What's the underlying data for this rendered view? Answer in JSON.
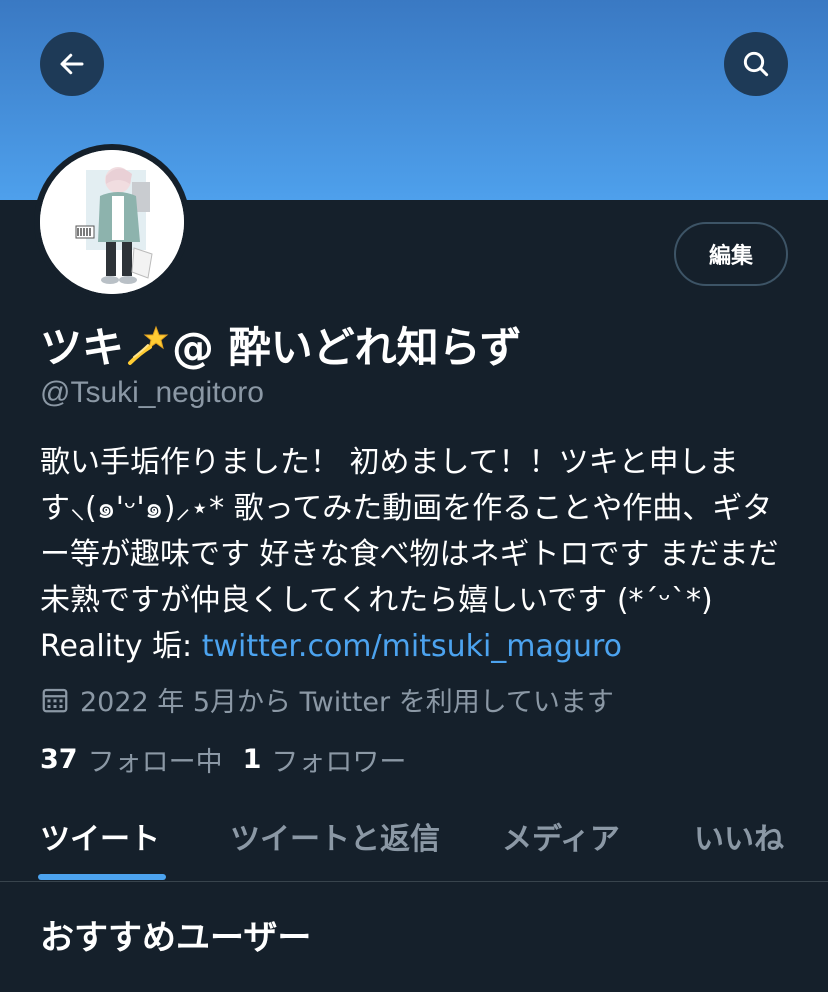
{
  "header": {
    "back_icon": "arrow-left-icon",
    "search_icon": "search-icon",
    "banner_color": "#4ea0ec"
  },
  "profile": {
    "edit_label": "編集",
    "name_prefix": "ツキ",
    "name_emoji": "dizzy-star-emoji",
    "name_suffix": "@ 酔いどれ知らず",
    "handle": "@Tsuki_negitoro",
    "bio_text": "歌い手垢作りました！ 初めまして！！ツキと申します⸜(๑'ᵕ'๑)⸝⋆* 歌ってみた動画を作ることや作曲、ギター等が趣味です 好きな食べ物はネギトロです まだまだ未熟ですが仲良くしてくれたら嬉しいです (*´ᵕ`*) Reality 垢: ",
    "bio_link": "twitter.com/mitsuki_maguro",
    "joined_icon": "calendar-icon",
    "joined_text": "2022 年 5月から Twitter を利用しています",
    "following_count": "37",
    "following_label": "フォロー中",
    "followers_count": "1",
    "followers_label": "フォロワー"
  },
  "tabs": [
    {
      "label": "ツイート",
      "active": true
    },
    {
      "label": "ツイートと返信",
      "active": false
    },
    {
      "label": "メディア",
      "active": false
    },
    {
      "label": "いいね",
      "active": false
    }
  ],
  "recommended": {
    "title": "おすすめユーザー"
  },
  "colors": {
    "background": "#15202b",
    "accent": "#4ca3ef",
    "secondary_text": "#8b98a5"
  }
}
